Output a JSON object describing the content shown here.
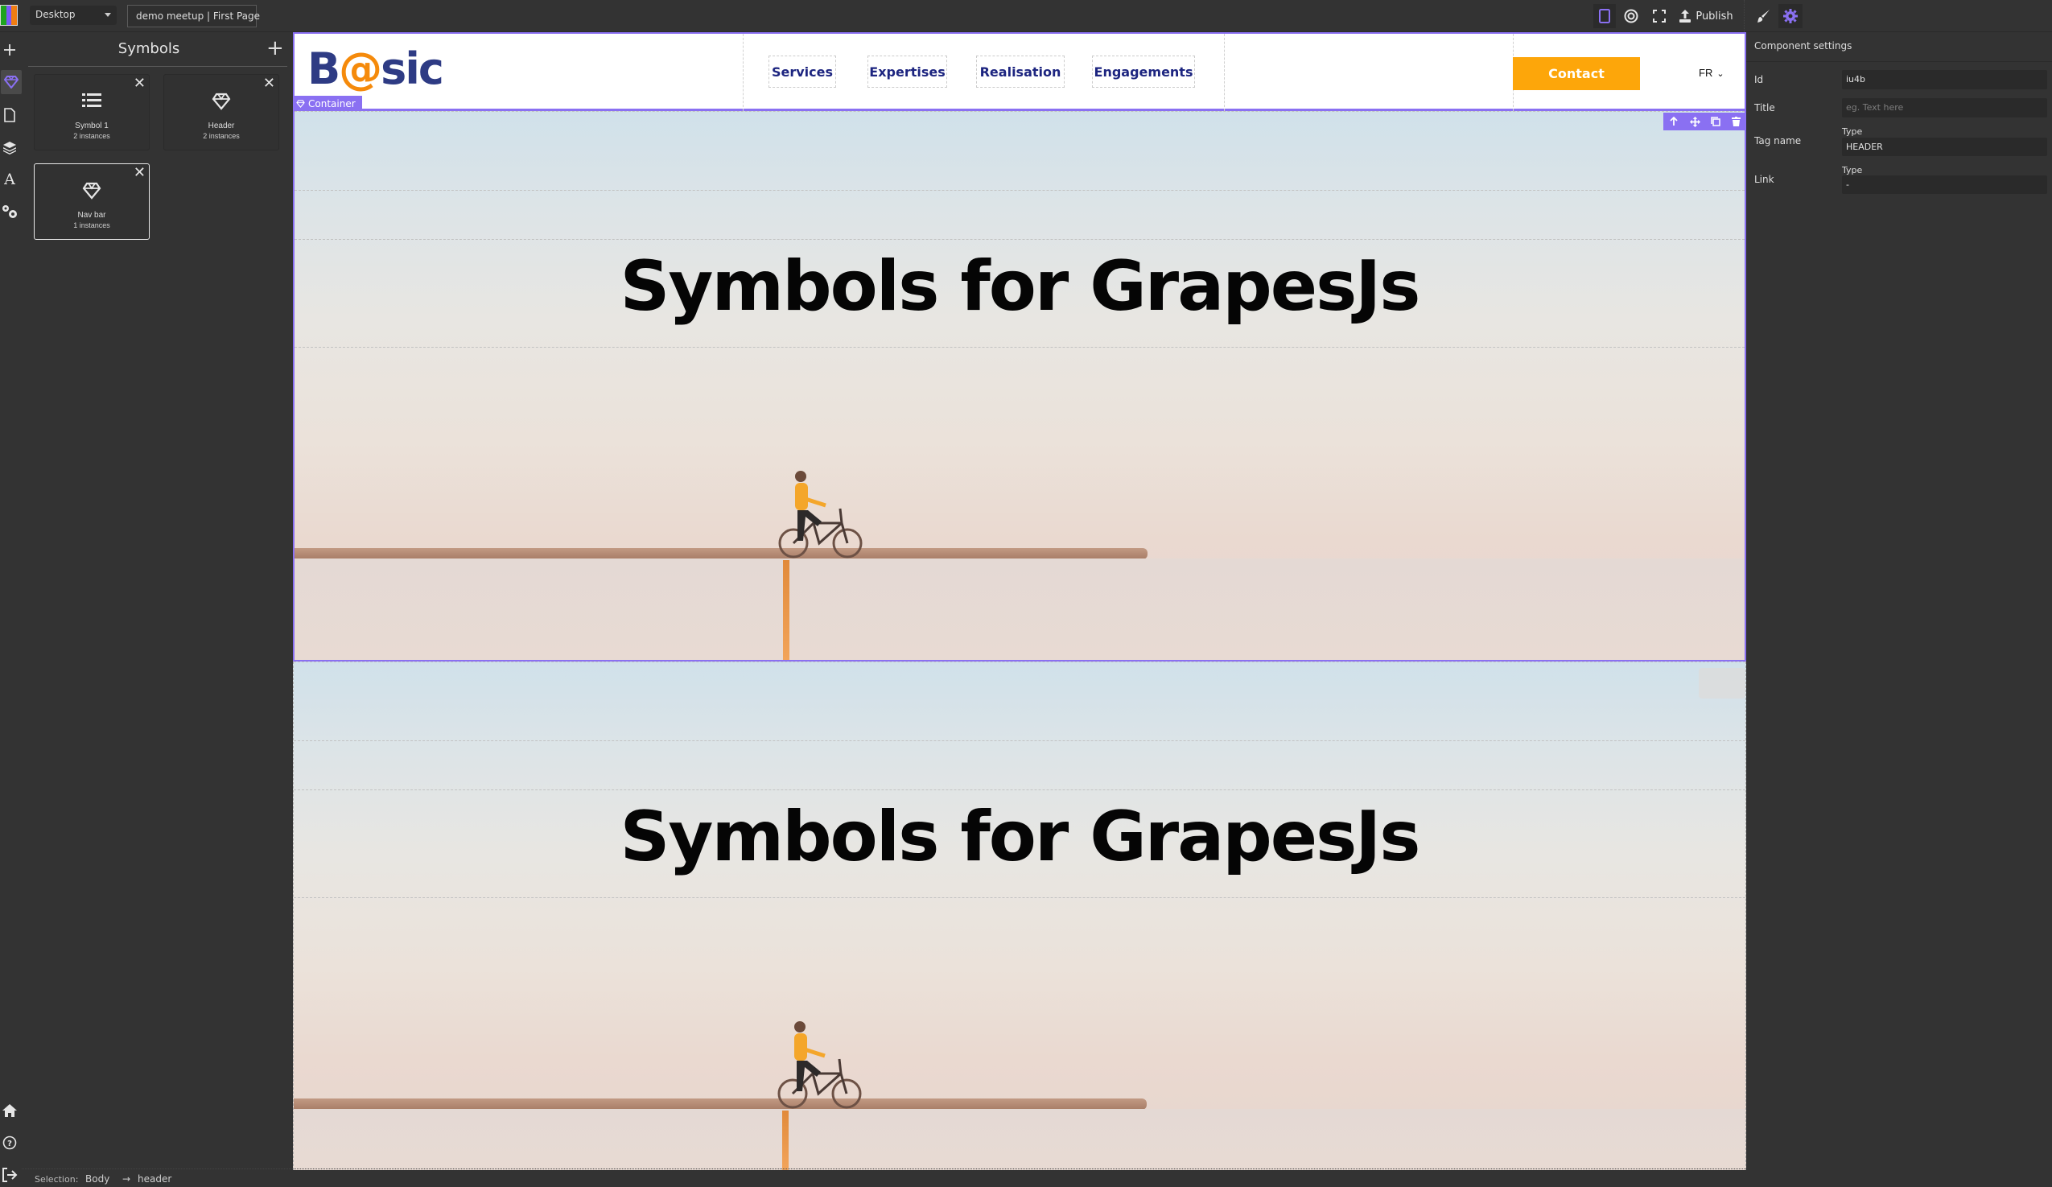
{
  "topbar": {
    "device_selected": "Desktop",
    "page_name": "demo meetup | First Page",
    "publish_label": "Publish",
    "icons": [
      "component-outline-icon",
      "preview-eye-icon",
      "fullscreen-icon",
      "upload-icon",
      "brush-icon",
      "gear-icon"
    ]
  },
  "left_strip": {
    "icons": [
      "add-plus-icon",
      "symbol-diamond-icon",
      "page-icon",
      "layers-icon",
      "typography-icon",
      "settings-gears-icon",
      "home-icon",
      "help-icon",
      "logout-icon"
    ],
    "active": "symbol-diamond-icon"
  },
  "symbols_panel": {
    "title": "Symbols",
    "add_label": "+",
    "items": [
      {
        "name": "Symbol 1",
        "count": "2 instances",
        "icon": "list-icon",
        "selected": false
      },
      {
        "name": "Header",
        "count": "2 instances",
        "icon": "diamond-icon",
        "selected": false
      },
      {
        "name": "Nav bar",
        "count": "1 instances",
        "icon": "diamond-icon",
        "selected": true
      }
    ]
  },
  "canvas": {
    "header": {
      "brand_prefix": "B",
      "brand_at": "@",
      "brand_suffix": "sic",
      "nav": [
        "Services",
        "Expertises",
        "Realisation",
        "Engagements"
      ],
      "contact_label": "Contact",
      "language": "FR"
    },
    "selection_badge": "Container",
    "selection_toolbar": [
      "select-parent-icon",
      "move-icon",
      "clone-icon",
      "delete-icon"
    ],
    "sections": [
      {
        "title": "Symbols for GrapesJs"
      },
      {
        "title": "Symbols for GrapesJs"
      }
    ],
    "colors": {
      "brand_blue": "#2e3b84",
      "brand_orange": "#f58a0b",
      "nav_text": "#1d2580",
      "contact_bg": "#fda60a",
      "selection_accent": "#8a70f2"
    }
  },
  "right_panel": {
    "title": "Component settings",
    "fields": [
      {
        "label": "Id",
        "value": "iu4b",
        "placeholder": ""
      },
      {
        "label": "Title",
        "value": "",
        "placeholder": "eg. Text here"
      },
      {
        "label": "Tag name",
        "sublabel": "Type",
        "value": "HEADER"
      },
      {
        "label": "Link",
        "sublabel": "Type",
        "value": "-"
      }
    ]
  },
  "statusbar": {
    "label": "Selection:",
    "crumbs": [
      "Body",
      "header"
    ],
    "separator": "→"
  }
}
